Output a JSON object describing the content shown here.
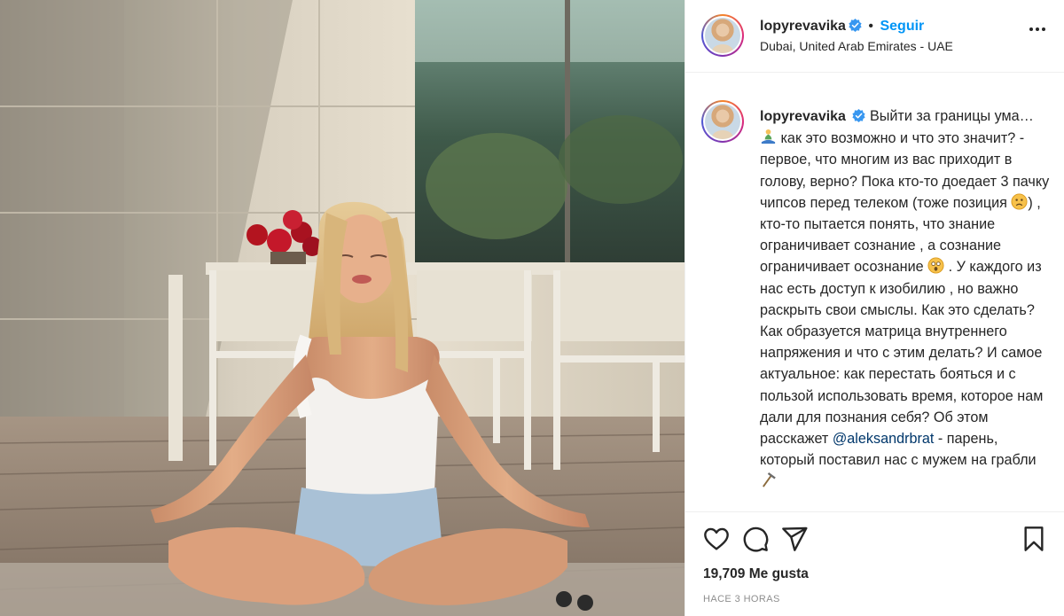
{
  "post": {
    "username": "lopyrevavika",
    "follow_label": "Seguir",
    "separator": "•",
    "location": "Dubai, United Arab Emirates - UAE",
    "caption_parts": [
      "Выйти за границы ума… ",
      " как это возможно и что это значит? - первое, что многим из вас приходит в голову, верно? Пока кто-то доедает 3 пачку чипсов перед телеком (тоже позиция ",
      ") , кто-то пытается понять, что знание ограничивает сознание , а сознание ограничивает осознание ",
      " . У каждого из нас есть доступ к изобилию , но важно раскрыть свои смыслы. Как это сделать? Как образуется матрица внутреннего напряжения и что с этим делать? И самое актуальное: как перестать бояться и с пользой использовать время, которое нам дали для познания себя? Об этом расскажет ",
      " - парень, который поставил нас с мужем на грабли "
    ],
    "mention": "@aleksandrbrat",
    "likes_count": "19,709",
    "likes_label": "Me gusta",
    "time_ago": "HACE 3 HORAS"
  },
  "icons": {
    "verified": "verified-badge-icon",
    "more": "more-options-icon",
    "like": "heart-icon",
    "comment": "comment-icon",
    "share": "paper-plane-icon",
    "save": "bookmark-icon",
    "emoji_1": "meditation-emoji-icon",
    "emoji_2": "sad-face-emoji-icon",
    "emoji_3": "astonished-face-emoji-icon",
    "emoji_4": "rake-emoji-icon"
  },
  "colors": {
    "accent_link": "#0095f6",
    "mention": "#00376b",
    "verified": "#3897f0",
    "text": "#262626",
    "muted": "#8e8e8e"
  }
}
